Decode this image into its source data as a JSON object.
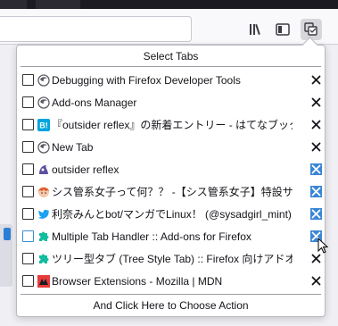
{
  "toolbar": {
    "buttons": [
      {
        "icon": "library-icon"
      },
      {
        "icon": "sidebar-icon"
      },
      {
        "icon": "multiple-tab-handler-icon",
        "active": true
      }
    ]
  },
  "popup": {
    "header": "Select Tabs",
    "footer": "And Click Here to Choose Action",
    "tabs": [
      {
        "title": "Debugging with Firefox Developer Tools",
        "favicon": "firefox-logo-icon",
        "close_highlight": false
      },
      {
        "title": "Add-ons Manager",
        "favicon": "firefox-logo-icon",
        "close_highlight": false
      },
      {
        "title": "『outsider reflex』の新着エントリー - はてなブックマーク",
        "favicon": "hatena-bookmark-icon",
        "favicon_text": "B!",
        "close_highlight": false
      },
      {
        "title": "New Tab",
        "favicon": "firefox-logo-icon",
        "close_highlight": false
      },
      {
        "title": "outsider reflex",
        "favicon": "outsider-reflex-icon",
        "close_highlight": true
      },
      {
        "title": "シス管系女子って何？？ -【シス管系女子】特設サイト",
        "favicon": "character-icon",
        "close_highlight": true
      },
      {
        "title": "利奈みんとbot/マンガでLinux！ (@sysadgirl_mint) | Twitter",
        "favicon": "twitter-bird-icon",
        "close_highlight": true
      },
      {
        "title": "Multiple Tab Handler :: Add-ons for Firefox",
        "favicon": "puzzle-piece-icon",
        "close_highlight": true
      },
      {
        "title": "ツリー型タブ (Tree Style Tab) :: Firefox 向けアドオン",
        "favicon": "puzzle-piece-icon",
        "close_highlight": false
      },
      {
        "title": "Browser Extensions - Mozilla | MDN",
        "favicon": "mdn-icon",
        "close_highlight": false
      }
    ]
  },
  "colors": {
    "accent": "#3a86d6",
    "addon_green": "#12bc9e",
    "twitter_blue": "#1da1f2"
  }
}
